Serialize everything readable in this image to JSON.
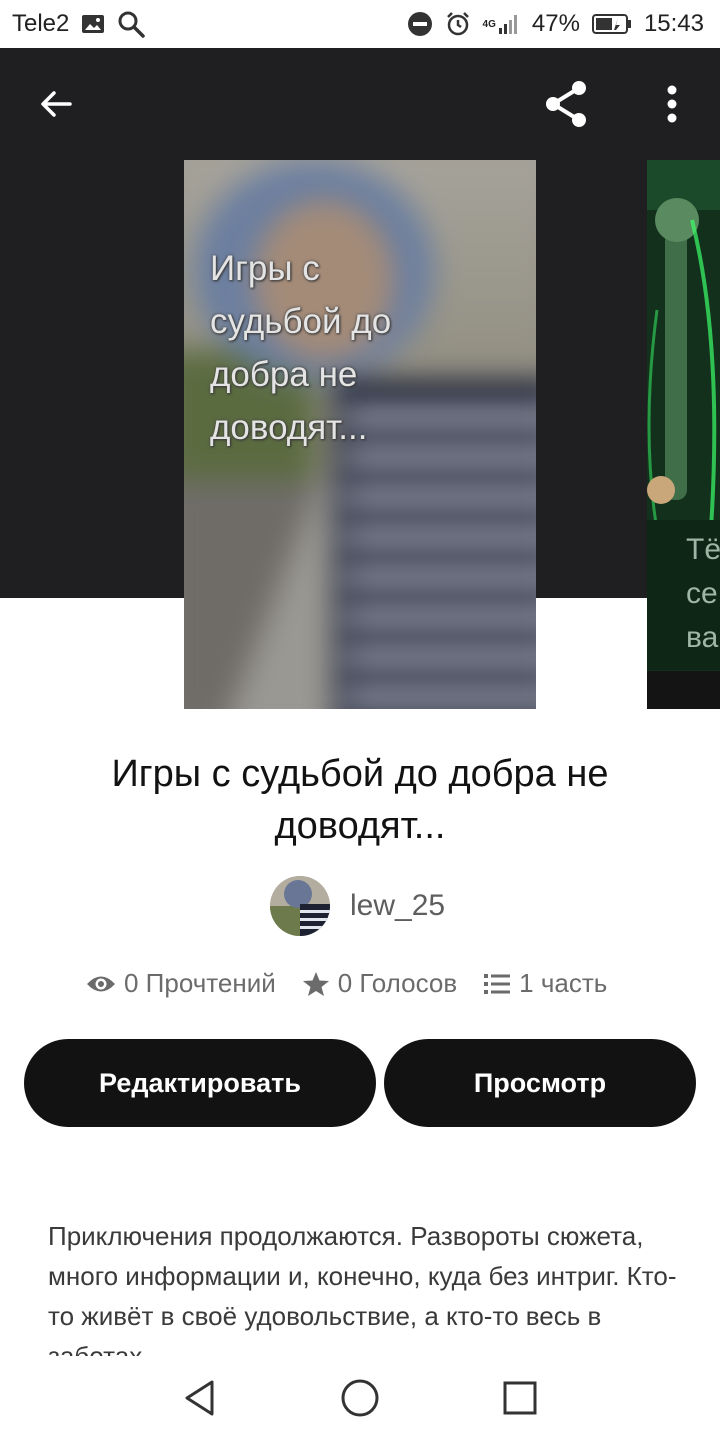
{
  "status_bar": {
    "carrier": "Tele2",
    "network": "4G",
    "battery": "47%",
    "time": "15:43",
    "icons": [
      "image-icon",
      "search-icon",
      "dnd-icon",
      "alarm-icon",
      "signal-icon",
      "battery-icon"
    ]
  },
  "toolbar": {
    "back_icon": "arrow-back-icon",
    "share_icon": "share-icon",
    "more_icon": "more-vertical-icon"
  },
  "cover": {
    "title_text": "Игры с судьбой до добра не доводят...",
    "next_cover_text": "Тё\nсе\nва"
  },
  "story": {
    "title": "Игры с судьбой до добра не доводят...",
    "author": "lew_25"
  },
  "stats": {
    "reads": "0 Прочтений",
    "votes": "0 Голосов",
    "parts": "1 часть"
  },
  "buttons": {
    "edit": "Редактировать",
    "preview": "Просмотр"
  },
  "description": "Приключения продолжаются. Развороты сюжета, много информации и, конечно, куда без интриг. Кто-то живёт в своё удовольствие, а кто-то весь в заботах...",
  "nav": {
    "back": "triangle-back-icon",
    "home": "circle-home-icon",
    "recents": "square-recents-icon"
  },
  "colors": {
    "header_bg": "#1f1e20",
    "button_bg": "#121212",
    "button_text": "#ffffff",
    "text_primary": "#121212",
    "text_secondary": "#6b6b6b"
  }
}
